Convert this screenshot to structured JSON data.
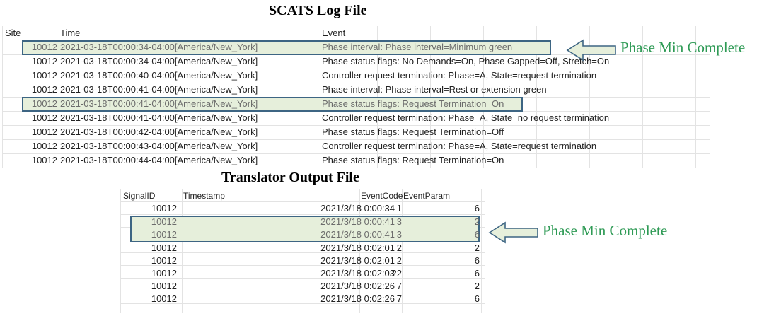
{
  "scats": {
    "title": "SCATS Log File",
    "headers": {
      "site": "Site",
      "time": "Time",
      "event": "Event"
    },
    "rows": [
      {
        "site": "10012",
        "time": "2021-03-18T00:00:34-04:00[America/New_York]",
        "event": "Phase interval: Phase interval=Minimum green",
        "highlighted": true
      },
      {
        "site": "10012",
        "time": "2021-03-18T00:00:34-04:00[America/New_York]",
        "event": "Phase status flags: No Demands=On, Phase Gapped=Off, Stretch=On",
        "highlighted": false
      },
      {
        "site": "10012",
        "time": "2021-03-18T00:00:40-04:00[America/New_York]",
        "event": "Controller request termination: Phase=A, State=request termination",
        "highlighted": false
      },
      {
        "site": "10012",
        "time": "2021-03-18T00:00:41-04:00[America/New_York]",
        "event": "Phase interval: Phase interval=Rest or extension green",
        "highlighted": false
      },
      {
        "site": "10012",
        "time": "2021-03-18T00:00:41-04:00[America/New_York]",
        "event": "Phase status flags: Request Termination=On",
        "highlighted": true
      },
      {
        "site": "10012",
        "time": "2021-03-18T00:00:41-04:00[America/New_York]",
        "event": "Controller request termination: Phase=A, State=no request termination",
        "highlighted": false
      },
      {
        "site": "10012",
        "time": "2021-03-18T00:00:42-04:00[America/New_York]",
        "event": "Phase status flags: Request Termination=Off",
        "highlighted": false
      },
      {
        "site": "10012",
        "time": "2021-03-18T00:00:43-04:00[America/New_York]",
        "event": "Controller request termination: Phase=A, State=request termination",
        "highlighted": false
      },
      {
        "site": "10012",
        "time": "2021-03-18T00:00:44-04:00[America/New_York]",
        "event": "Phase status flags: Request Termination=On",
        "highlighted": false
      }
    ],
    "annotation": "Phase Min Complete"
  },
  "translator": {
    "title": "Translator Output File",
    "headers": {
      "signal_id": "SignalID",
      "timestamp": "Timestamp",
      "event_code": "EventCode",
      "event_param": "EventParam"
    },
    "rows": [
      {
        "signal_id": "10012",
        "timestamp": "2021/3/18 0:00:34",
        "event_code": "1",
        "event_param": "6",
        "highlighted": false
      },
      {
        "signal_id": "10012",
        "timestamp": "2021/3/18 0:00:41",
        "event_code": "3",
        "event_param": "2",
        "highlighted": true
      },
      {
        "signal_id": "10012",
        "timestamp": "2021/3/18 0:00:41",
        "event_code": "3",
        "event_param": "6",
        "highlighted": true
      },
      {
        "signal_id": "10012",
        "timestamp": "2021/3/18 0:02:01",
        "event_code": "2",
        "event_param": "2",
        "highlighted": false
      },
      {
        "signal_id": "10012",
        "timestamp": "2021/3/18 0:02:01",
        "event_code": "2",
        "event_param": "6",
        "highlighted": false
      },
      {
        "signal_id": "10012",
        "timestamp": "2021/3/18 0:02:03",
        "event_code": "22",
        "event_param": "6",
        "highlighted": false
      },
      {
        "signal_id": "10012",
        "timestamp": "2021/3/18 0:02:26",
        "event_code": "7",
        "event_param": "2",
        "highlighted": false
      },
      {
        "signal_id": "10012",
        "timestamp": "2021/3/18 0:02:26",
        "event_code": "7",
        "event_param": "6",
        "highlighted": false
      }
    ],
    "annotation": "Phase Min Complete"
  },
  "colors": {
    "highlight_fill": "#e6efdb",
    "highlight_border": "#3d6583",
    "annotation_text": "#2e9a55",
    "grid": "#e3e3e3"
  }
}
